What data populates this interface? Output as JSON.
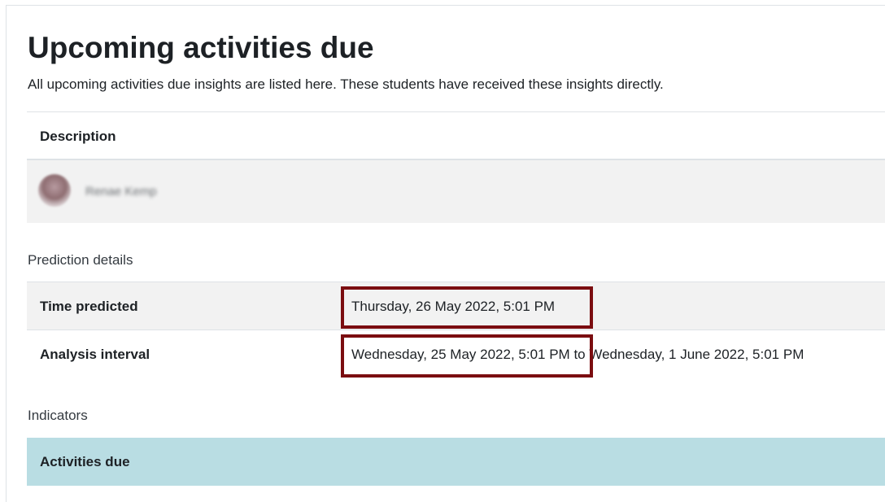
{
  "header": {
    "title": "Upcoming activities due",
    "subtitle": "All upcoming activities due insights are listed here. These students have received these insights directly."
  },
  "table": {
    "column_header": "Description",
    "student": {
      "name": "Renae Kemp",
      "avatar_icon": "user-avatar"
    }
  },
  "prediction_details": {
    "section_label": "Prediction details",
    "time_predicted": {
      "label": "Time predicted",
      "value": "Thursday, 26 May 2022, 5:01 PM"
    },
    "analysis_interval": {
      "label": "Analysis interval",
      "start": "Wednesday, 25 May 2022, 5:01 PM",
      "connector": "to",
      "end": "Wednesday, 1 June 2022, 5:01 PM"
    }
  },
  "indicators": {
    "section_label": "Indicators",
    "items": [
      {
        "label": "Activities due"
      }
    ]
  },
  "colors": {
    "highlight_border": "#7b0d10",
    "indicator_background": "#b9dde3",
    "row_shade": "#f2f2f2"
  }
}
